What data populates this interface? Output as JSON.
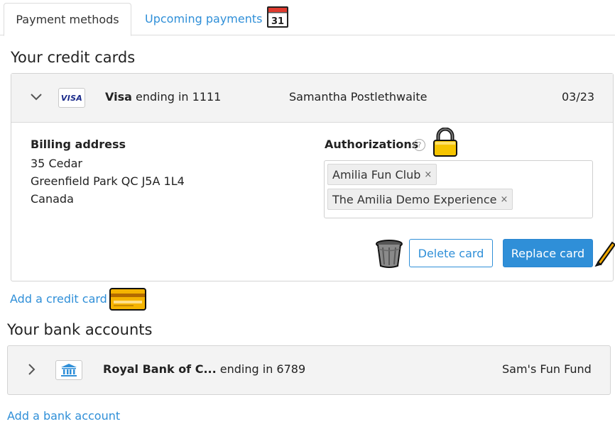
{
  "tabs": {
    "active_label": "Payment methods",
    "upcoming_label": "Upcoming payments",
    "calendar_day": "31"
  },
  "credit_cards": {
    "heading": "Your credit cards",
    "card": {
      "brand_badge": "VISA",
      "brand": "Visa",
      "ending_text": "ending in 1111",
      "holder": "Samantha Postlethwaite",
      "expiry": "03/23",
      "billing": {
        "label": "Billing address",
        "line1": "35 Cedar",
        "line2": "Greenfield Park QC J5A 1L4",
        "line3": "Canada"
      },
      "authorizations": {
        "label": "Authorizations",
        "help_glyph": "?",
        "items": [
          "Amilia Fun Club",
          "The Amilia Demo Experience"
        ],
        "remove_glyph": "×"
      },
      "delete_label": "Delete card",
      "replace_label": "Replace card"
    },
    "add_label": "Add a credit card"
  },
  "bank_accounts": {
    "heading": "Your bank accounts",
    "account": {
      "bank_name": "Royal Bank of C...",
      "ending_text": "ending in 6789",
      "nickname": "Sam's Fun Fund"
    },
    "add_label": "Add a bank account"
  },
  "colors": {
    "accent": "#2f8fd8",
    "panel_header": "#f3f3f3",
    "border": "#d4d4d4"
  },
  "icons": [
    "calendar-icon",
    "chevron-down-icon",
    "visa-icon",
    "help-icon",
    "lock-icon",
    "trash-icon",
    "pencil-icon",
    "credit-card-icon",
    "chevron-right-icon",
    "bank-icon"
  ]
}
